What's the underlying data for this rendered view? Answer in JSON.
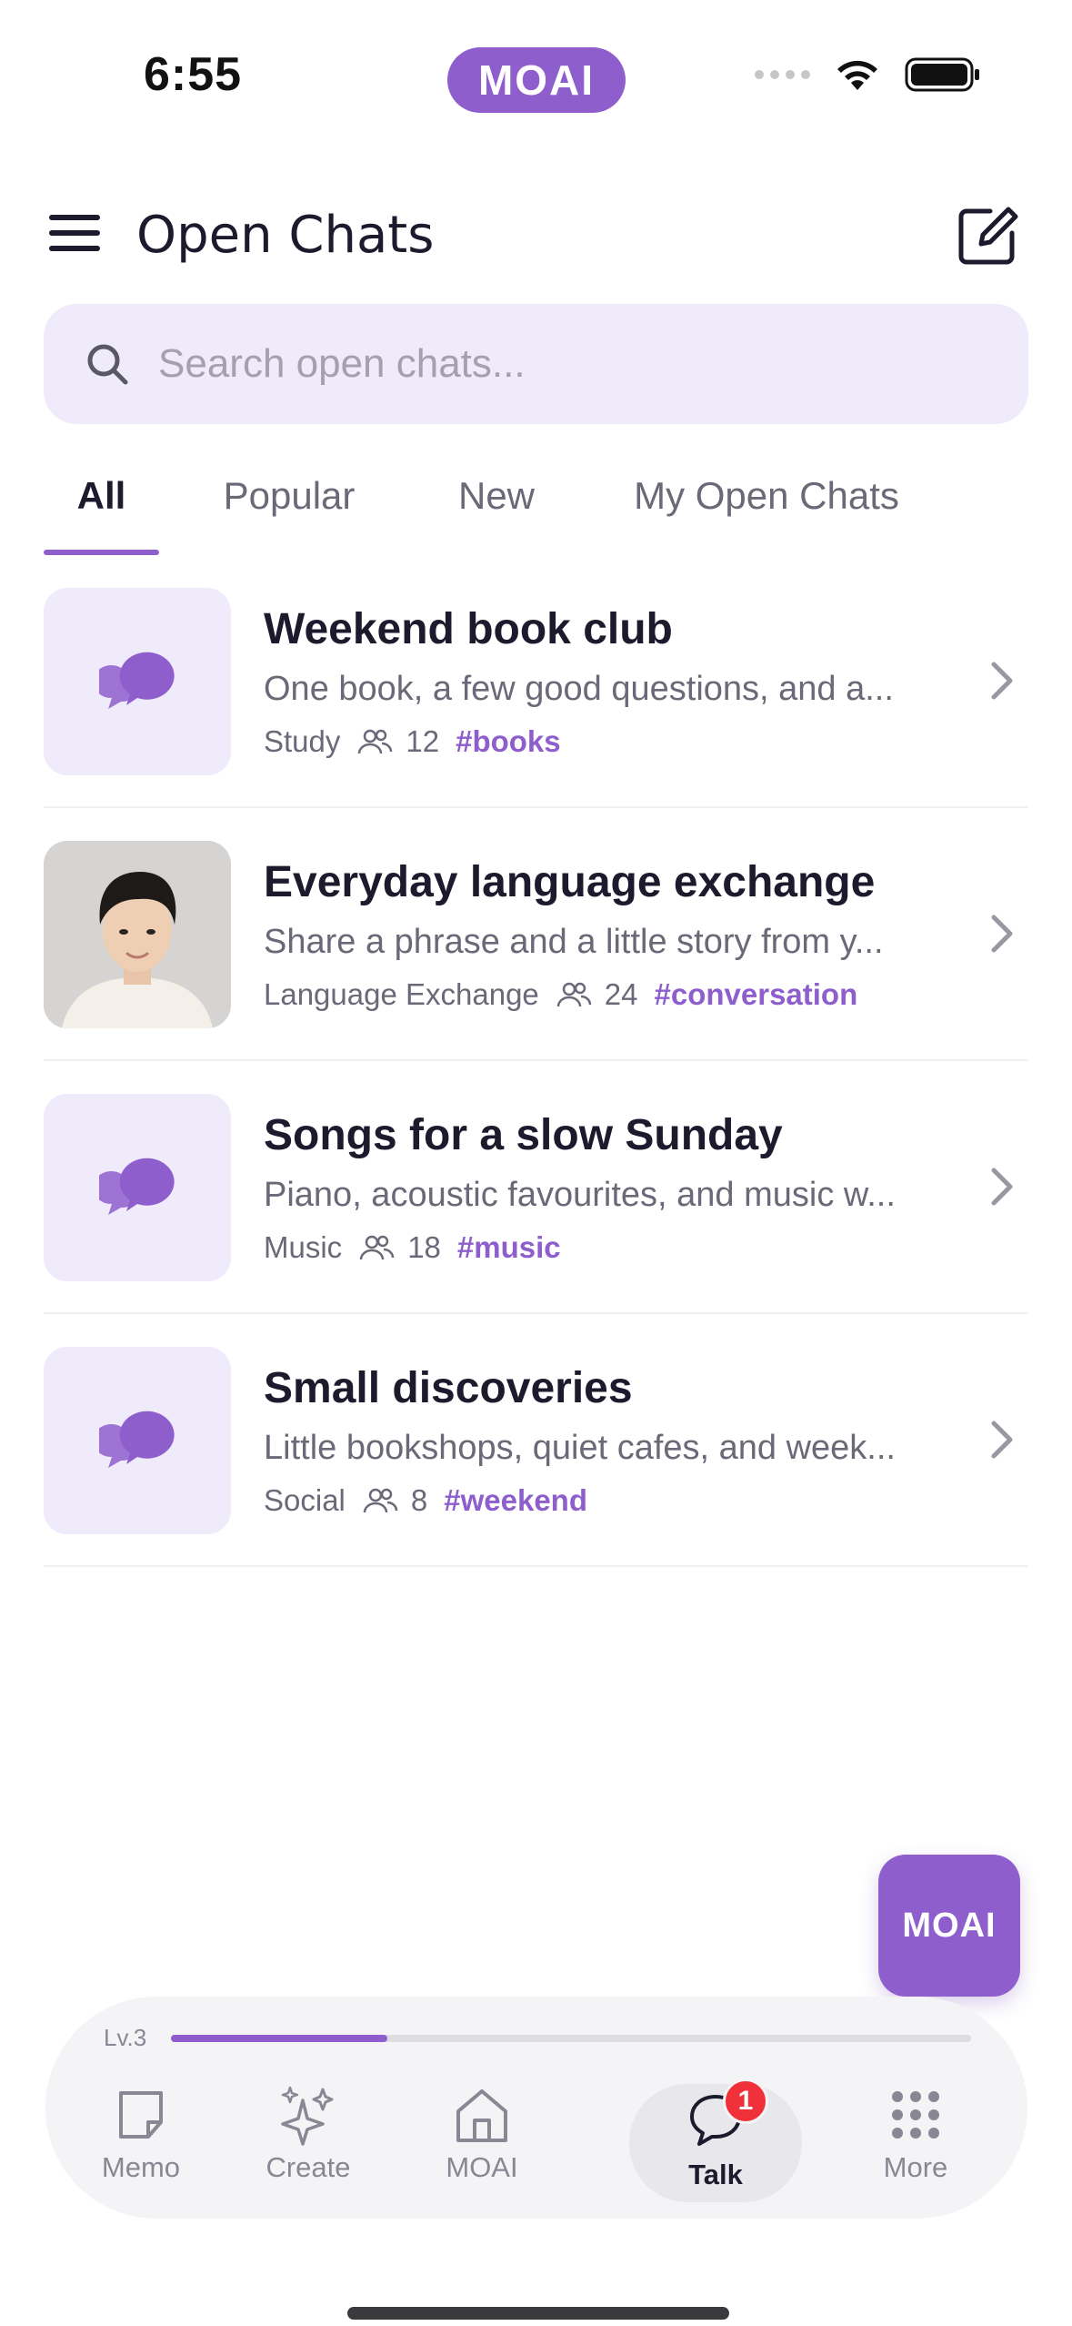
{
  "status_bar": {
    "time": "6:55",
    "brand": "MOAI"
  },
  "header": {
    "title": "Open Chats"
  },
  "search": {
    "placeholder": "Search open chats..."
  },
  "tabs": [
    {
      "label": "All",
      "active": true
    },
    {
      "label": "Popular",
      "active": false
    },
    {
      "label": "New",
      "active": false
    },
    {
      "label": "My Open Chats",
      "active": false
    }
  ],
  "chats": [
    {
      "title": "Weekend book club",
      "description": "One book, a few good questions, and a...",
      "category": "Study",
      "members": "12",
      "tag": "#books",
      "thumbnail": "chat-bubble-icon"
    },
    {
      "title": "Everyday language exchange",
      "description": "Share a phrase and a little story from y...",
      "category": "Language Exchange",
      "members": "24",
      "tag": "#conversation",
      "thumbnail": "host-photo"
    },
    {
      "title": "Songs for a slow Sunday",
      "description": "Piano, acoustic favourites, and music w...",
      "category": "Music",
      "members": "18",
      "tag": "#music",
      "thumbnail": "chat-bubble-icon"
    },
    {
      "title": "Small discoveries",
      "description": "Little bookshops, quiet cafes, and week...",
      "category": "Social",
      "members": "8",
      "tag": "#weekend",
      "thumbnail": "chat-bubble-icon"
    }
  ],
  "fab": {
    "label": "MOAI"
  },
  "level": {
    "label": "Lv.3",
    "progress": 0.27
  },
  "bottom_nav": [
    {
      "label": "Memo",
      "icon": "memo-icon",
      "active": false
    },
    {
      "label": "Create",
      "icon": "sparkle-icon",
      "active": false
    },
    {
      "label": "MOAI",
      "icon": "home-icon",
      "active": false
    },
    {
      "label": "Talk",
      "icon": "talk-icon",
      "active": true,
      "badge": "1"
    },
    {
      "label": "More",
      "icon": "grid-icon",
      "active": false
    }
  ],
  "colors": {
    "accent": "#8e5fcc",
    "accent_light": "#efebfb",
    "badge": "#f0313a"
  }
}
